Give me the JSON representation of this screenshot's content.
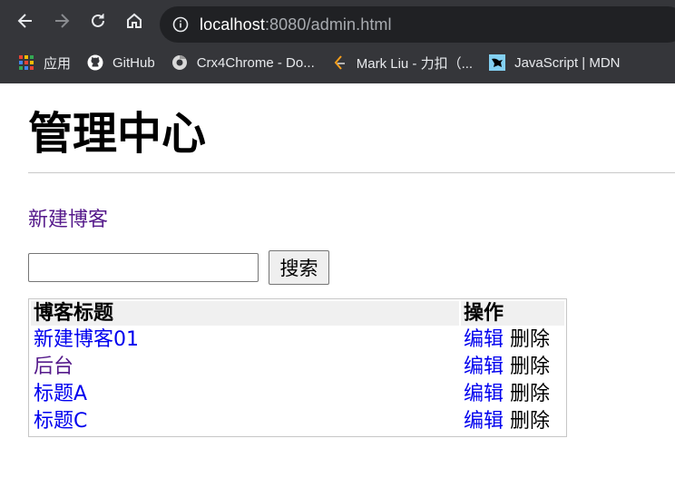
{
  "browser": {
    "url_host": "localhost",
    "url_rest": ":8080/admin.html",
    "bookmarks": [
      {
        "label": "应用",
        "icon": "apps-grid-icon"
      },
      {
        "label": "GitHub",
        "icon": "github-icon"
      },
      {
        "label": "Crx4Chrome - Do...",
        "icon": "crx4chrome-icon"
      },
      {
        "label": "Mark Liu - 力扣（...",
        "icon": "leetcode-icon"
      },
      {
        "label": "JavaScript | MDN",
        "icon": "mdn-icon"
      }
    ]
  },
  "page": {
    "title": "管理中心",
    "new_blog_link": "新建博客",
    "search": {
      "placeholder": "",
      "button_label": "搜索"
    },
    "table": {
      "headers": [
        "博客标题",
        "操作"
      ],
      "rows": [
        {
          "title": "新建博客01",
          "edit": "编辑",
          "delete": "删除"
        },
        {
          "title": "后台",
          "edit": "编辑",
          "delete": "删除"
        },
        {
          "title": "标题A",
          "edit": "编辑",
          "delete": "删除"
        },
        {
          "title": "标题C",
          "edit": "编辑",
          "delete": "删除"
        }
      ]
    }
  },
  "colors": {
    "chrome_bg": "#35363a",
    "omnibox_bg": "#202124",
    "link": "#0000ee",
    "visited_link": "#551a8b"
  }
}
